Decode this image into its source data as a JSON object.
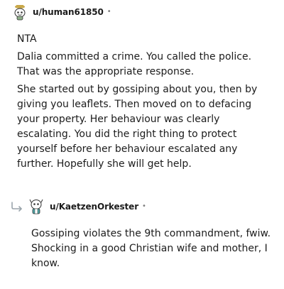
{
  "comment": {
    "username": "u/human61850",
    "avatar_icon": "snoo-avatar-icon",
    "separator": "•",
    "paragraphs": [
      "NTA",
      "Dalia committed a crime. You called the police. That was the appropriate response.",
      "She started out by gossiping about you, then by giving you leaflets. Then moved on to defacing your property. Her behaviour was clearly escalating. You did the right thing to protect yourself before her behaviour escalated any further. Hopefully she will get help."
    ]
  },
  "reply": {
    "reply_icon": "reply-arrow-icon",
    "avatar_icon": "snoo-avatar-icon",
    "username": "u/KaetzenOrkester",
    "separator": "•",
    "paragraphs": [
      "Gossiping violates the 9th commandment, fwiw. Shocking in a good Christian wife and mother, I know."
    ]
  },
  "colors": {
    "text": "#1c1c1c",
    "meta": "#7c7c7c",
    "background": "#ffffff"
  }
}
